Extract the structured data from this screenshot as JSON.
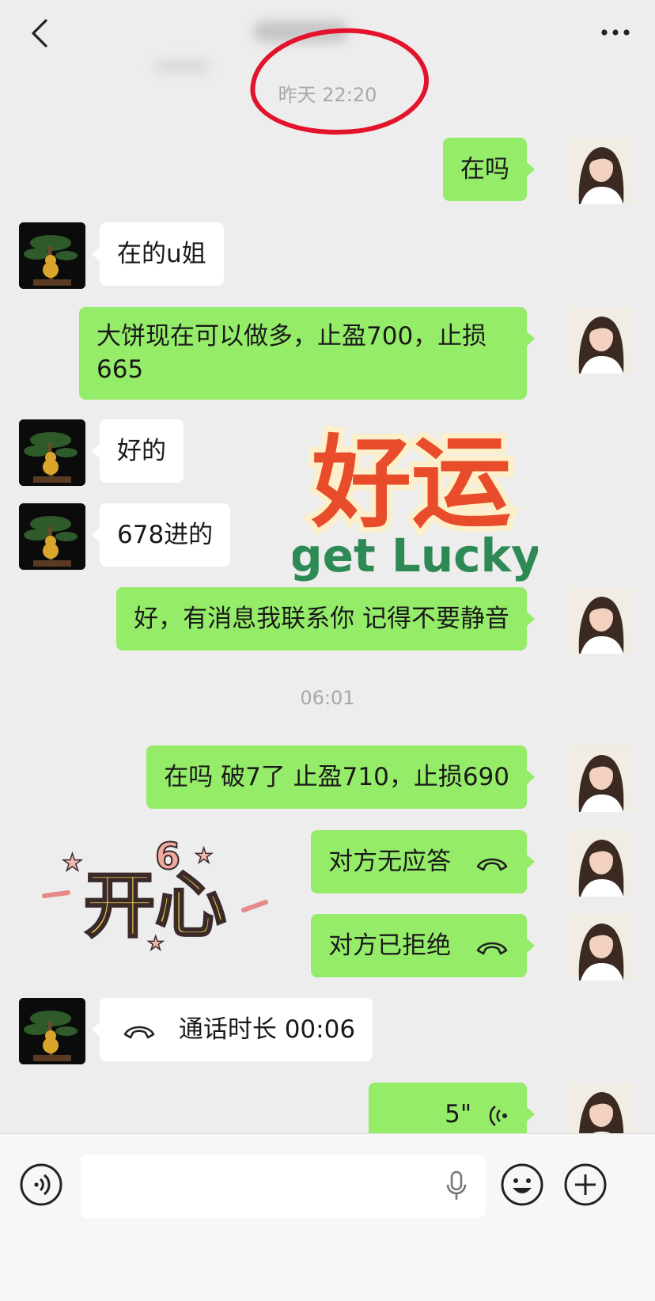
{
  "header": {
    "back_icon": "chevron-left-icon",
    "more_icon": "more-dots-icon"
  },
  "timestamps": [
    "昨天 22:20",
    "06:01"
  ],
  "messages": [
    {
      "from": "me",
      "text": "在吗"
    },
    {
      "from": "other",
      "text": "在的u姐"
    },
    {
      "from": "me",
      "text": "大饼现在可以做多，止盈700，止损665"
    },
    {
      "from": "other",
      "text": "好的"
    },
    {
      "from": "other",
      "text": "678进的"
    },
    {
      "from": "me",
      "text": "好，有消息我联系你 记得不要静音"
    },
    {
      "from": "me",
      "text": "在吗 破7了 止盈710，止损690"
    },
    {
      "from": "me",
      "text": "对方无应答",
      "icon": "phone-hangup-icon"
    },
    {
      "from": "me",
      "text": "对方已拒绝",
      "icon": "phone-hangup-icon"
    },
    {
      "from": "other",
      "text": "通话时长 00:06",
      "icon": "phone-hangup-icon"
    },
    {
      "from": "me",
      "text": "5\"",
      "icon": "voice-wave-icon"
    }
  ],
  "stickers": {
    "lucky": {
      "cn": "好运",
      "en": "get Lucky"
    },
    "happy": {
      "cn": "开心",
      "mark": "6"
    }
  },
  "colors": {
    "my_bubble": "#95ec69",
    "other_bubble": "#ffffff",
    "background": "#ededed",
    "annotation": "#e3132b"
  }
}
